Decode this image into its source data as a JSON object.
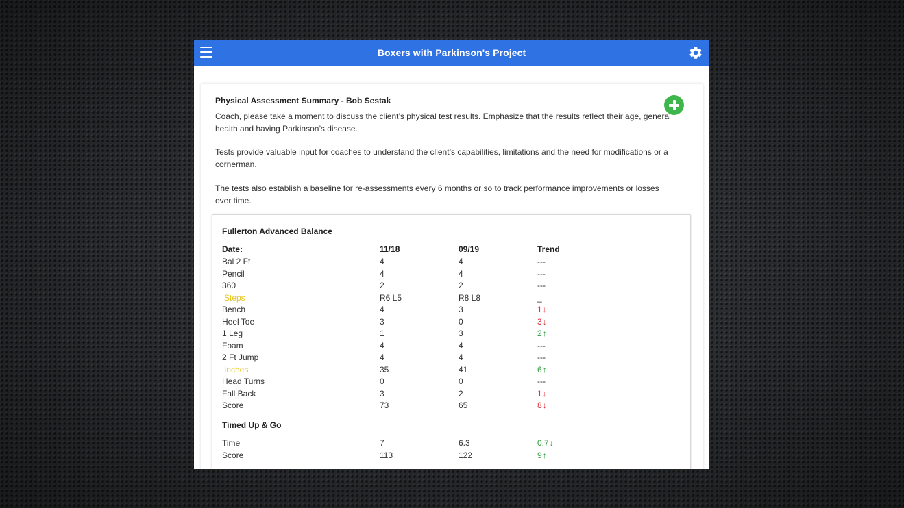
{
  "header": {
    "title": "Boxers with Parkinson's Project"
  },
  "summary": {
    "title": "Physical Assessment Summary - Bob Sestak",
    "paragraphs": [
      "Coach, please take a moment to discuss the client’s physical test results. Emphasize that the results reflect their age, general health and having Parkinson’s disease.",
      "Tests provide valuable input for coaches to understand the client’s capabilities, limitations and the need for modifications or a cornerman.",
      "The tests also establish a baseline for re-assessments every 6 months or so to track performance improvements or losses over time."
    ]
  },
  "colors": {
    "header_bg": "#2f72e4",
    "add_button": "#3fb64b",
    "highlight": "#e6c41d",
    "trend_up": "#2c9a3a",
    "trend_down": "#d9343b"
  },
  "balance": {
    "title": "Fullerton Advanced Balance",
    "columns": [
      "Date:",
      "11/18",
      "09/19",
      "Trend"
    ],
    "rows": [
      {
        "label": "Bal 2 Ft",
        "v1": "4",
        "v2": "4",
        "trend": "---",
        "dir": "none"
      },
      {
        "label": "Pencil",
        "v1": "4",
        "v2": "4",
        "trend": "---",
        "dir": "none"
      },
      {
        "label": "360",
        "v1": "2",
        "v2": "2",
        "trend": "---",
        "dir": "none"
      },
      {
        "label": "Steps",
        "v1": "R6 L5",
        "v2": "R8 L8",
        "trend": "_",
        "dir": "none",
        "highlight": true
      },
      {
        "label": "Bench",
        "v1": "4",
        "v2": "3",
        "trend": "1",
        "dir": "down"
      },
      {
        "label": "Heel Toe",
        "v1": "3",
        "v2": "0",
        "trend": "3",
        "dir": "down"
      },
      {
        "label": "1 Leg",
        "v1": "1",
        "v2": "3",
        "trend": "2",
        "dir": "up"
      },
      {
        "label": "Foam",
        "v1": "4",
        "v2": "4",
        "trend": "---",
        "dir": "none"
      },
      {
        "label": "2 Ft Jump",
        "v1": "4",
        "v2": "4",
        "trend": "---",
        "dir": "none"
      },
      {
        "label": "Inches",
        "v1": "35",
        "v2": "41",
        "trend": "6",
        "dir": "up",
        "highlight": true
      },
      {
        "label": "Head Turns",
        "v1": "0",
        "v2": "0",
        "trend": "---",
        "dir": "none"
      },
      {
        "label": "Fall Back",
        "v1": "3",
        "v2": "2",
        "trend": "1",
        "dir": "down"
      },
      {
        "label": "Score",
        "v1": "73",
        "v2": "65",
        "trend": "8",
        "dir": "down"
      }
    ]
  },
  "tug": {
    "title": "Timed Up & Go",
    "rows": [
      {
        "label": "Time",
        "v1": "7",
        "v2": "6.3",
        "trend": "0.7",
        "dir": "down",
        "color": "up"
      },
      {
        "label": "Score",
        "v1": "113",
        "v2": "122",
        "trend": "9",
        "dir": "up",
        "color": "up"
      }
    ]
  }
}
